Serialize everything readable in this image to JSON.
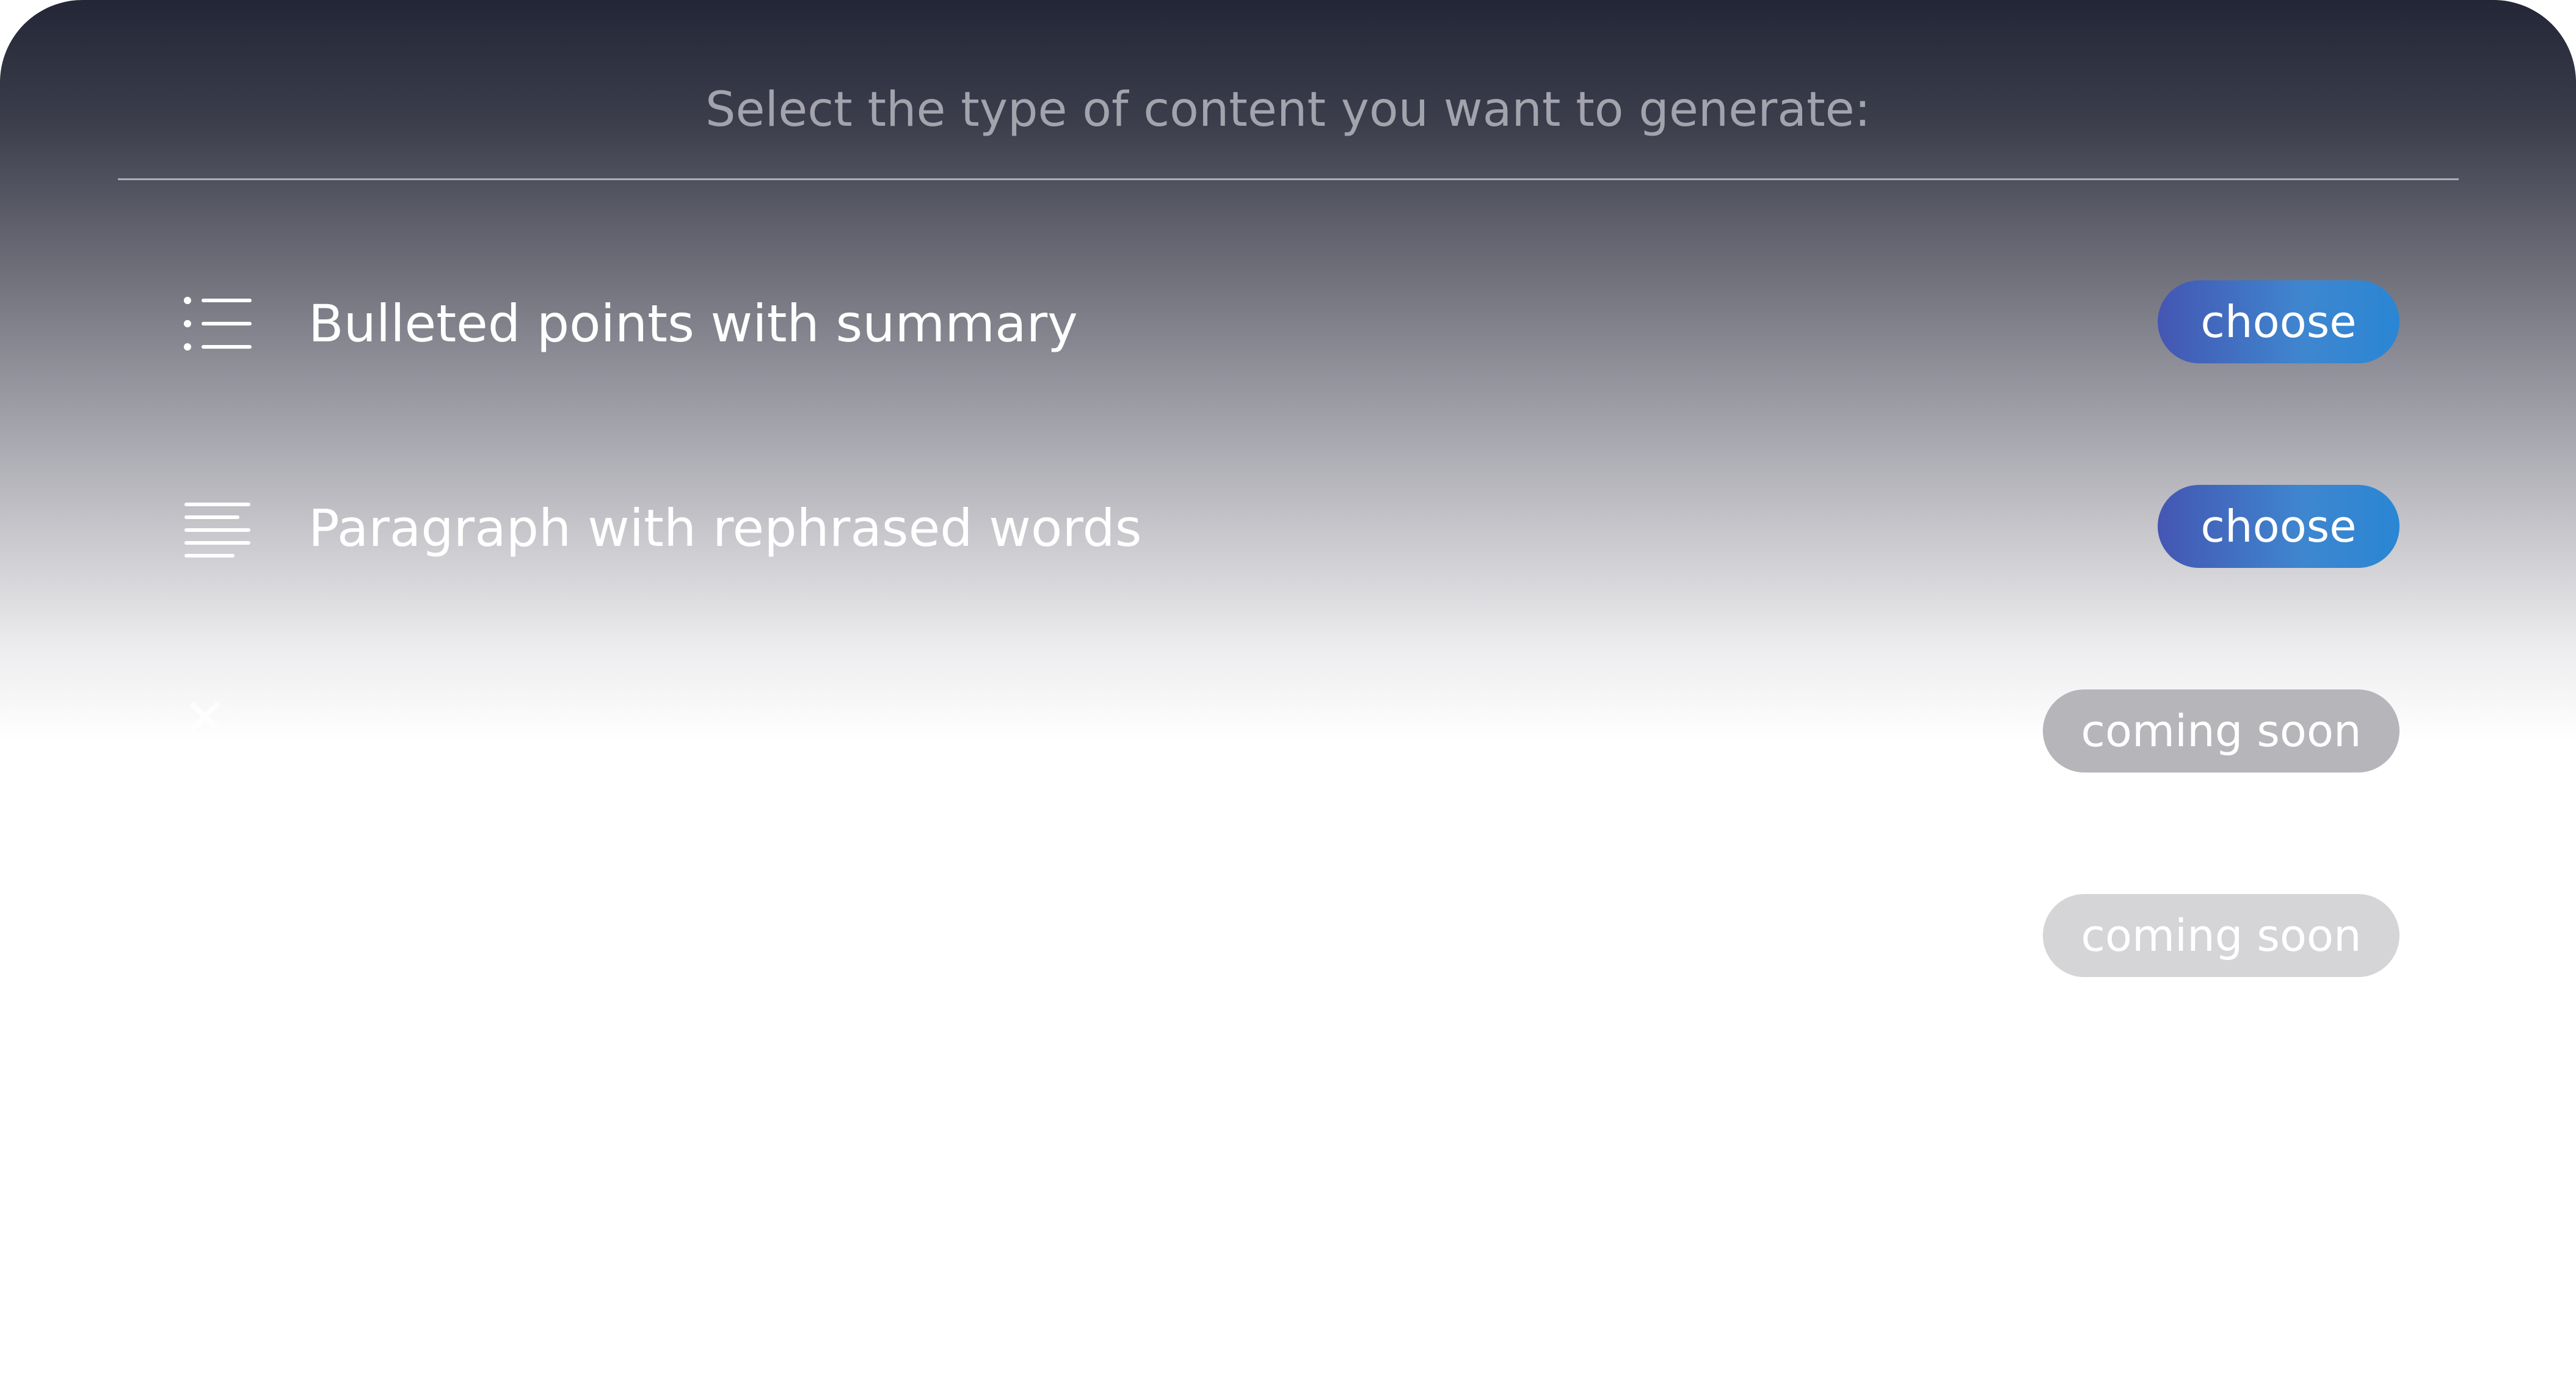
{
  "dialog": {
    "heading": "Select the type of content you want to generate:"
  },
  "options": [
    {
      "icon": "bulleted-list-icon",
      "label": "Bulleted points with summary",
      "button_label": "choose"
    },
    {
      "icon": "paragraph-lines-icon",
      "label": "Paragraph with rephrased words",
      "button_label": "choose"
    },
    {
      "icon": "unknown-icon",
      "label": "",
      "button_label": "coming soon"
    },
    {
      "icon": "",
      "label": "",
      "button_label": "coming soon"
    }
  ],
  "colors": {
    "choose_button_start": "#4456b3",
    "choose_button_end": "#2a86d4",
    "coming_soon_button": "#b5b5ba",
    "heading_text": "#a3a3ad",
    "panel_top": "#232636"
  }
}
